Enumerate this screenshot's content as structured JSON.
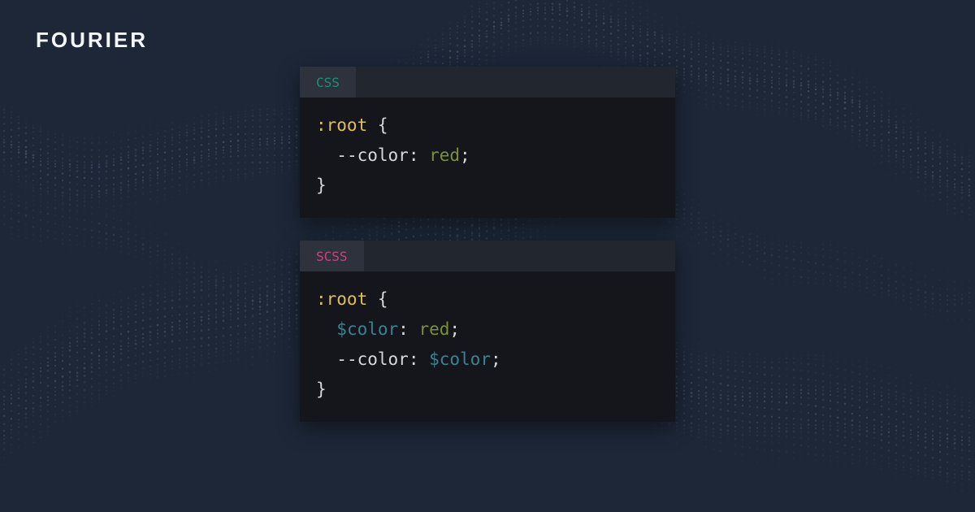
{
  "brand": "FOURIER",
  "colors": {
    "background": "#1d2738",
    "window_bg": "#14161c",
    "tabbar_bg": "#22262f",
    "tab_active_bg": "#2d323c",
    "css_tab_fg": "#1d8f7a",
    "scss_tab_fg": "#c9457a",
    "pseudo": "#e0be5c",
    "value": "#7a8f3a",
    "scss_var": "#3a8294",
    "default_fg": "#d6d8dc"
  },
  "windows": [
    {
      "id": "css",
      "tab_label": "CSS",
      "lines": [
        {
          "tokens": [
            {
              "t": ":root ",
              "c": "pseudo"
            },
            {
              "t": "{",
              "c": "brace"
            }
          ]
        },
        {
          "tokens": [
            {
              "t": "  ",
              "c": "plain"
            },
            {
              "t": "--",
              "c": "plain"
            },
            {
              "t": "color",
              "c": "plain"
            },
            {
              "t": ": ",
              "c": "plain"
            },
            {
              "t": "red",
              "c": "value"
            },
            {
              "t": ";",
              "c": "plain"
            }
          ]
        },
        {
          "tokens": [
            {
              "t": "}",
              "c": "brace"
            }
          ]
        }
      ]
    },
    {
      "id": "scss",
      "tab_label": "SCSS",
      "lines": [
        {
          "tokens": [
            {
              "t": ":root ",
              "c": "pseudo"
            },
            {
              "t": "{",
              "c": "brace"
            }
          ]
        },
        {
          "tokens": [
            {
              "t": "  ",
              "c": "plain"
            },
            {
              "t": "$color",
              "c": "scssvar"
            },
            {
              "t": ": ",
              "c": "plain"
            },
            {
              "t": "red",
              "c": "value"
            },
            {
              "t": ";",
              "c": "plain"
            }
          ]
        },
        {
          "tokens": [
            {
              "t": "  ",
              "c": "plain"
            },
            {
              "t": "--",
              "c": "plain"
            },
            {
              "t": "color",
              "c": "plain"
            },
            {
              "t": ": ",
              "c": "plain"
            },
            {
              "t": "$color",
              "c": "scssvar"
            },
            {
              "t": ";",
              "c": "plain"
            }
          ]
        },
        {
          "tokens": [
            {
              "t": "}",
              "c": "brace"
            }
          ]
        }
      ]
    }
  ]
}
